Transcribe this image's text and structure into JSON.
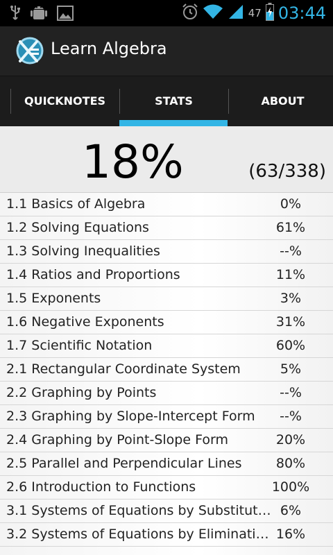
{
  "statusbar": {
    "battery_level": "47",
    "time": "03:44",
    "icons": [
      "usb-icon",
      "android-debug-icon",
      "image-notification-icon",
      "alarm-icon",
      "wifi-icon",
      "signal-icon",
      "battery-charging-icon"
    ]
  },
  "app": {
    "title": "Learn Algebra",
    "accent": "#33b5e5"
  },
  "tabs": [
    {
      "label": "QUICKNOTES",
      "selected": false
    },
    {
      "label": "STATS",
      "selected": true
    },
    {
      "label": "ABOUT",
      "selected": false
    }
  ],
  "summary": {
    "percent": "18%",
    "count": "(63/338)"
  },
  "rows": [
    {
      "label": "1.1 Basics of Algebra",
      "value": "0%"
    },
    {
      "label": "1.2 Solving Equations",
      "value": "61%"
    },
    {
      "label": "1.3 Solving Inequalities",
      "value": "--%"
    },
    {
      "label": "1.4 Ratios and Proportions",
      "value": "11%"
    },
    {
      "label": "1.5 Exponents",
      "value": "3%"
    },
    {
      "label": "1.6 Negative Exponents",
      "value": "31%"
    },
    {
      "label": "1.7 Scientific Notation",
      "value": "60%"
    },
    {
      "label": "2.1 Rectangular Coordinate System",
      "value": "5%"
    },
    {
      "label": "2.2 Graphing by Points",
      "value": "--%"
    },
    {
      "label": "2.3 Graphing by Slope-Intercept Form",
      "value": "--%"
    },
    {
      "label": "2.4 Graphing by Point-Slope Form",
      "value": "20%"
    },
    {
      "label": "2.5 Parallel and Perpendicular Lines",
      "value": "80%"
    },
    {
      "label": "2.6 Introduction to Functions",
      "value": "100%"
    },
    {
      "label": "3.1 Systems of Equations by Substitution",
      "value": "6%"
    },
    {
      "label": "3.2 Systems of Equations by Elimination",
      "value": "16%"
    }
  ]
}
